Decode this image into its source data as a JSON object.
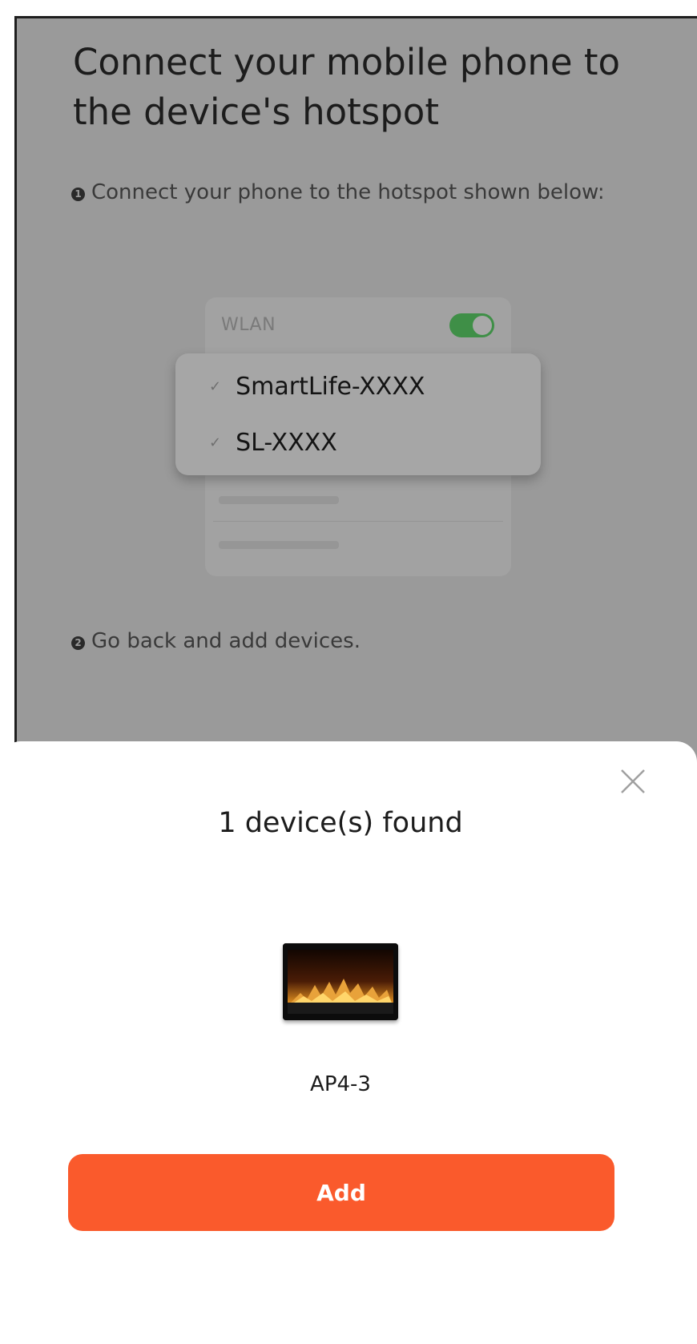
{
  "page": {
    "title": "Connect your mobile phone to the device's hotspot",
    "step1_number": "1",
    "step1_text": "Connect your phone to the hotspot shown below:",
    "step2_number": "2",
    "step2_text": "Go back and add devices."
  },
  "wifi_illustration": {
    "wlan_label": "WLAN",
    "toggle_on": true,
    "networks": [
      {
        "check": "✓",
        "name": "SmartLife-XXXX"
      },
      {
        "check": "✓",
        "name": "SL-XXXX"
      }
    ]
  },
  "sheet": {
    "title": "1 device(s) found",
    "device_name": "AP4-3",
    "add_label": "Add",
    "close_icon": "close-icon"
  },
  "colors": {
    "accent": "#fa5a2c",
    "toggle_on": "#3f8f47",
    "overlay": "#9a9a9a"
  }
}
